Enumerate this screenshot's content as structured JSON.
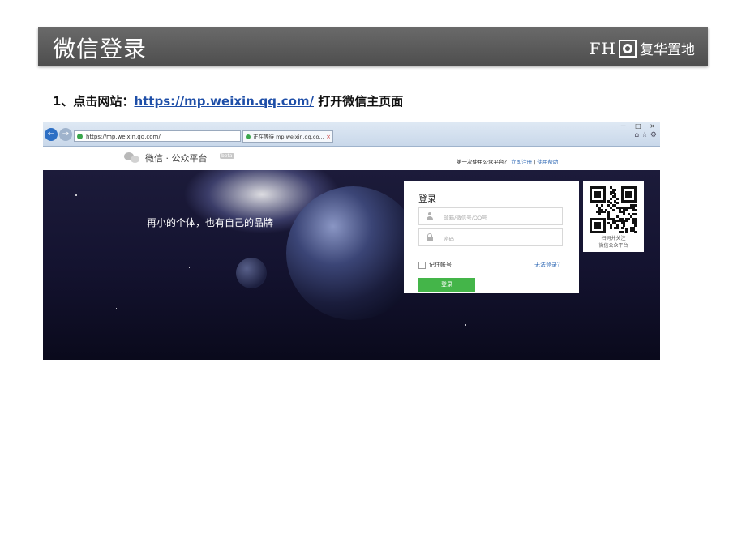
{
  "slide": {
    "title": "微信登录",
    "brand_latin": "FH",
    "brand_name": "复华置地",
    "step_prefix": "1、点击网站：",
    "step_link": "https://mp.weixin.qq.com/",
    "step_suffix": " 打开微信主页面"
  },
  "browser": {
    "address": "https://mp.weixin.qq.com/",
    "tab_label": "正在等待 mp.weixin.qq.co...",
    "tab_close": "×",
    "back_glyph": "←",
    "forward_glyph": "→",
    "window_controls": "－ □ ×",
    "toolbar_glyphs": "⌂ ☆ ⚙"
  },
  "wechat": {
    "brand": "微信 · 公众平台",
    "beta_badge": "beta",
    "first_time_text": "第一次使用公众平台？",
    "register_link": "立即注册",
    "separator": " | ",
    "help_link": "使用帮助",
    "slogan": "再小的个体，也有自己的品牌",
    "login": {
      "title": "登录",
      "username_placeholder": "邮箱/微信号/QQ号",
      "password_placeholder": "密码",
      "remember_label": "记住帐号",
      "forgot_link": "无法登录？",
      "submit_label": "登录"
    },
    "qr": {
      "line1": "扫码并关注",
      "line2": "微信公众平台"
    }
  },
  "colors": {
    "header_bg": "#555555",
    "link": "#1f4fa8",
    "wechat_green": "#44b549"
  }
}
